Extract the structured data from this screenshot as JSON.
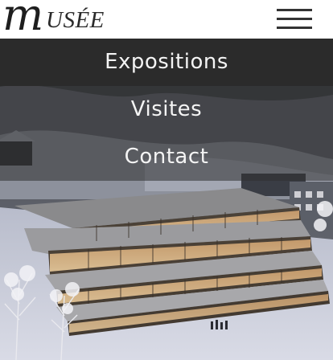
{
  "header": {
    "logo_mark": "m",
    "logo_word": "USÉE",
    "menu_icon": "hamburger-menu-icon"
  },
  "nav": {
    "items": [
      {
        "label": "Expositions"
      },
      {
        "label": "Visites"
      },
      {
        "label": "Contact"
      }
    ]
  },
  "hero": {
    "image": "snowy-terraced-hotel-building-at-dusk"
  },
  "colors": {
    "nav_active_bg": "#2b2b2b",
    "nav_text": "#f4f4f4",
    "logo": "#1e1e1e"
  }
}
